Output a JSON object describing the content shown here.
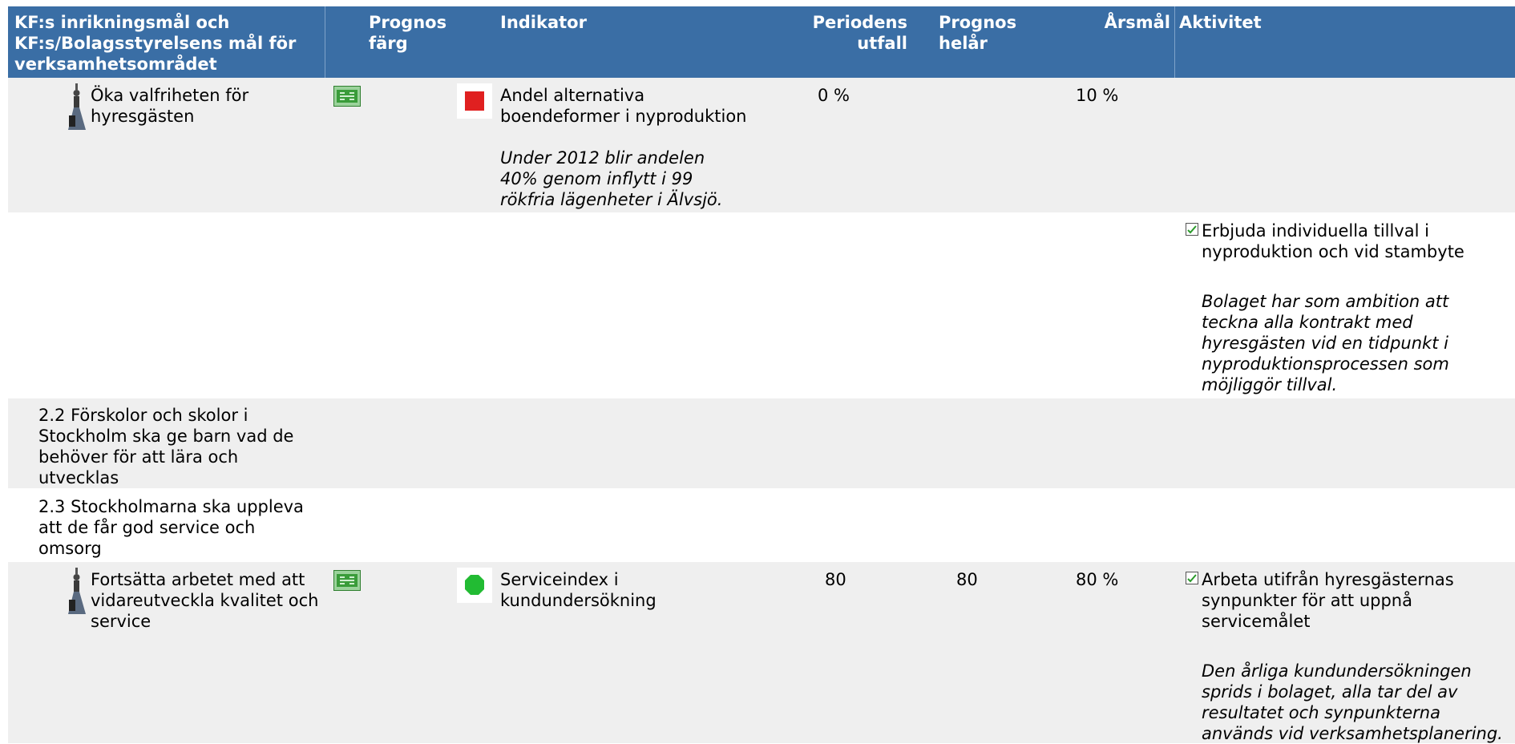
{
  "header": {
    "goal": "KF:s inrikningsmål och KF:s/Bolagsstyrelsens mål för verksamhetsområdet",
    "prognos_farg": "Prognos färg",
    "indikator": "Indikator",
    "periodens_utfall": "Periodens utfall",
    "prognos_helar": "Prognos helår",
    "arsmal": "Årsmål",
    "aktivitet": "Aktivitet"
  },
  "rows": {
    "r1": {
      "goal": "Öka valfriheten för hyresgästen",
      "indicator": "Andel alternativa boendeformer i nyproduktion",
      "comment": "Under 2012 blir andelen 40% genom inflytt i 99 rökfria lägenheter i Älvsjö.",
      "periodens_utfall": "0 %",
      "arsmal": "10 %",
      "status_color": "#e02020"
    },
    "r2": {
      "activity": "Erbjuda individuella tillval i nyproduktion och vid stambyte",
      "comment": "Bolaget har som ambition att teckna alla kontrakt med hyresgästen vid en tidpunkt i nyproduktionsprocessen som möjliggör tillval."
    },
    "r3": {
      "goal": "2.2 Förskolor och skolor i Stockholm ska ge barn vad de behöver för att lära och utvecklas"
    },
    "r4": {
      "goal": "2.3 Stockholmarna ska uppleva att de får god service och omsorg"
    },
    "r5": {
      "goal": "Fortsätta arbetet med att vidareutveckla kvalitet och service",
      "indicator": "Serviceindex i kundundersökning",
      "periodens_utfall": "80",
      "prognos_helar": "80",
      "arsmal": "80 %",
      "status_color": "#22bb33",
      "activity": "Arbeta utifrån hyresgästernas synpunkter för att uppnå servicemålet",
      "comment": "Den årliga kundundersökningen sprids i bolaget, alla tar del av resultatet och synpunkterna används vid verksamhetsplanering."
    }
  }
}
